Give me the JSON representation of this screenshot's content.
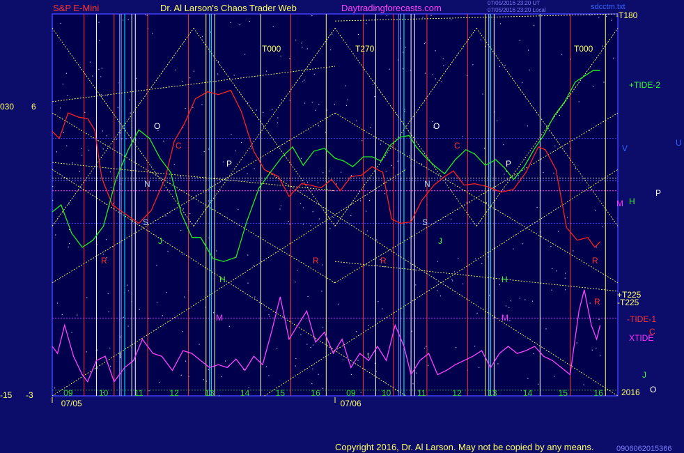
{
  "header": {
    "market": "S&P E-Mini",
    "site": "Dr. Al Larson's Chaos Trader Web",
    "url": "Daytradingforecasts.com",
    "stamp1": "07/05/2016 23:20 UT",
    "stamp2": "07/05/2016 23:20 Local",
    "file": "sdcctm.txt"
  },
  "footer": {
    "copyright": "Copyright 2016, Dr. Al Larson. May not be copied by any means.",
    "code": "0906062015366"
  },
  "chart_data": {
    "type": "line",
    "x_dates": [
      "07/05",
      "07/06"
    ],
    "x_ticks": [
      "09",
      "10",
      "11",
      "12",
      "13",
      "14",
      "15",
      "16",
      "09",
      "10",
      "11",
      "12",
      "13",
      "14",
      "15",
      "16"
    ],
    "year_label": "2016",
    "left_axis_labels": [
      {
        "text": "030",
        "color": "#ffff66"
      },
      {
        "text": "6",
        "color": "#ffff66"
      },
      {
        "text": "-15",
        "color": "#ffff66"
      },
      {
        "text": "-3",
        "color": "#ffff66"
      }
    ],
    "right_labels": [
      {
        "text": "-T180",
        "color": "#ffff66"
      },
      {
        "text": "+TIDE-2",
        "color": "#33ff33"
      },
      {
        "text": "V",
        "color": "#3366ff"
      },
      {
        "text": "U",
        "color": "#3366ff"
      },
      {
        "text": "P",
        "color": "#ffffff"
      },
      {
        "text": "H",
        "color": "#33ff33"
      },
      {
        "text": "M",
        "color": "#ff33ff"
      },
      {
        "text": "+T225",
        "color": "#ffff66"
      },
      {
        "text": "-T225",
        "color": "#ffff66"
      },
      {
        "text": "-TIDE-1",
        "color": "#ff3333"
      },
      {
        "text": "C",
        "color": "#ff3333"
      },
      {
        "text": "XTIDE",
        "color": "#ff33ff"
      },
      {
        "text": "J",
        "color": "#33ff33"
      },
      {
        "text": "2016",
        "color": "#ffff66"
      },
      {
        "text": "O",
        "color": "#ffffff"
      }
    ],
    "top_labels": [
      "T000",
      "T270",
      "T000"
    ],
    "event_letters": [
      {
        "text": "O",
        "color": "#ffffff"
      },
      {
        "text": "C",
        "color": "#ff3333"
      },
      {
        "text": "N",
        "color": "#aaddff"
      },
      {
        "text": "P",
        "color": "#ffffff"
      },
      {
        "text": "S",
        "color": "#aaddff"
      },
      {
        "text": "J",
        "color": "#33ff33"
      },
      {
        "text": "R",
        "color": "#ff3333"
      },
      {
        "text": "H",
        "color": "#33ff33"
      },
      {
        "text": "M",
        "color": "#ff33ff"
      },
      {
        "text": "R",
        "color": "#ff3333"
      },
      {
        "text": "O",
        "color": "#ffffff"
      },
      {
        "text": "C",
        "color": "#ff3333"
      },
      {
        "text": "N",
        "color": "#aaddff"
      },
      {
        "text": "P",
        "color": "#ffffff"
      },
      {
        "text": "S",
        "color": "#aaddff"
      },
      {
        "text": "J",
        "color": "#33ff33"
      },
      {
        "text": "R",
        "color": "#ff3333"
      },
      {
        "text": "H",
        "color": "#33ff33"
      },
      {
        "text": "M",
        "color": "#ff33ff"
      },
      {
        "text": "R",
        "color": "#ff3333"
      },
      {
        "text": "R",
        "color": "#ff3333"
      },
      {
        "text": "t",
        "color": "#aaaaaa"
      },
      {
        "text": "t",
        "color": "#aaaaaa"
      }
    ],
    "series": [
      {
        "name": "-TIDE-1",
        "color": "#ff2020",
        "points": [
          [
            0,
            3.7
          ],
          [
            0.2,
            3.2
          ],
          [
            0.45,
            5.0
          ],
          [
            0.75,
            4.7
          ],
          [
            1.0,
            4.6
          ],
          [
            1.2,
            3.8
          ],
          [
            1.4,
            0.4
          ],
          [
            1.7,
            -1.5
          ],
          [
            2.1,
            -2.2
          ],
          [
            2.45,
            -2.8
          ],
          [
            2.8,
            -1.9
          ],
          [
            3.2,
            0.4
          ],
          [
            3.45,
            3.0
          ],
          [
            3.75,
            4.3
          ],
          [
            4.05,
            6.0
          ],
          [
            4.4,
            6.5
          ],
          [
            4.7,
            6.3
          ],
          [
            5.05,
            6.6
          ],
          [
            5.35,
            5.1
          ],
          [
            5.7,
            2.3
          ],
          [
            6.0,
            1.0
          ],
          [
            6.4,
            0.5
          ],
          [
            6.7,
            -0.9
          ],
          [
            7.05,
            0.0
          ],
          [
            7.3,
            -0.1
          ],
          [
            7.6,
            -0.3
          ],
          [
            7.9,
            0.3
          ],
          [
            8.15,
            -0.5
          ],
          [
            8.45,
            0.5
          ],
          [
            8.75,
            0.6
          ],
          [
            9.05,
            1.2
          ],
          [
            9.35,
            0.8
          ],
          [
            9.6,
            -2.5
          ],
          [
            9.85,
            -2.8
          ],
          [
            10.15,
            -2.7
          ],
          [
            10.45,
            -1.2
          ],
          [
            10.8,
            -0.1
          ],
          [
            11.1,
            0.5
          ],
          [
            11.35,
            0.9
          ],
          [
            11.65,
            -0.1
          ],
          [
            11.95,
            0.0
          ],
          [
            12.3,
            -0.2
          ],
          [
            12.7,
            -0.6
          ],
          [
            13.05,
            -0.4
          ],
          [
            13.4,
            0.8
          ],
          [
            13.75,
            2.6
          ],
          [
            13.95,
            2.4
          ],
          [
            14.25,
            1.0
          ],
          [
            14.55,
            -3.1
          ],
          [
            14.85,
            -4.0
          ],
          [
            15.15,
            -3.8
          ],
          [
            15.35,
            -4.5
          ],
          [
            15.5,
            -4.1
          ]
        ]
      },
      {
        "name": "+TIDE-2",
        "color": "#20ee20",
        "points": [
          [
            0,
            -2.0
          ],
          [
            0.25,
            -1.5
          ],
          [
            0.55,
            -3.5
          ],
          [
            0.85,
            -4.5
          ],
          [
            1.15,
            -4.0
          ],
          [
            1.45,
            -3.0
          ],
          [
            1.8,
            0.3
          ],
          [
            2.15,
            2.4
          ],
          [
            2.45,
            3.8
          ],
          [
            2.75,
            3.2
          ],
          [
            3.05,
            1.8
          ],
          [
            3.35,
            0.8
          ],
          [
            3.65,
            -2.1
          ],
          [
            3.95,
            -3.8
          ],
          [
            4.2,
            -3.8
          ],
          [
            4.55,
            -5.3
          ],
          [
            4.85,
            -5.5
          ],
          [
            5.2,
            -5.2
          ],
          [
            5.5,
            -2.7
          ],
          [
            5.85,
            -0.3
          ],
          [
            6.2,
            0.9
          ],
          [
            6.5,
            1.9
          ],
          [
            6.8,
            2.6
          ],
          [
            7.1,
            1.3
          ],
          [
            7.4,
            2.3
          ],
          [
            7.7,
            2.5
          ],
          [
            8.0,
            1.8
          ],
          [
            8.25,
            1.6
          ],
          [
            8.5,
            1.2
          ],
          [
            8.8,
            1.9
          ],
          [
            9.05,
            1.9
          ],
          [
            9.3,
            1.6
          ],
          [
            9.55,
            2.7
          ],
          [
            9.85,
            3.3
          ],
          [
            10.1,
            3.4
          ],
          [
            10.3,
            2.6
          ],
          [
            10.55,
            1.9
          ],
          [
            10.8,
            1.3
          ],
          [
            11.1,
            0.7
          ],
          [
            11.4,
            1.7
          ],
          [
            11.7,
            2.4
          ],
          [
            11.95,
            2.1
          ],
          [
            12.25,
            1.3
          ],
          [
            12.55,
            1.7
          ],
          [
            12.8,
            1.1
          ],
          [
            13.05,
            0.3
          ],
          [
            13.35,
            1.2
          ],
          [
            13.65,
            2.5
          ],
          [
            13.9,
            3.4
          ],
          [
            14.2,
            4.8
          ],
          [
            14.5,
            5.8
          ],
          [
            14.8,
            7.2
          ],
          [
            15.05,
            7.6
          ],
          [
            15.3,
            8.0
          ],
          [
            15.5,
            8.0
          ]
        ]
      },
      {
        "name": "XTIDE",
        "color": "#ff44ff",
        "points": [
          [
            0,
            -11.5
          ],
          [
            0.15,
            -12.0
          ],
          [
            0.35,
            -10.0
          ],
          [
            0.6,
            -12.2
          ],
          [
            0.85,
            -13.5
          ],
          [
            1.0,
            -14.0
          ],
          [
            1.25,
            -12.5
          ],
          [
            1.5,
            -12.2
          ],
          [
            1.75,
            -14.0
          ],
          [
            2.05,
            -13.0
          ],
          [
            2.3,
            -12.5
          ],
          [
            2.55,
            -11.0
          ],
          [
            2.85,
            -12.0
          ],
          [
            3.1,
            -12.2
          ],
          [
            3.4,
            -13.2
          ],
          [
            3.7,
            -11.8
          ],
          [
            3.95,
            -12.0
          ],
          [
            4.2,
            -12.5
          ],
          [
            4.45,
            -13.0
          ],
          [
            4.7,
            -12.8
          ],
          [
            4.95,
            -13.0
          ],
          [
            5.2,
            -12.4
          ],
          [
            5.45,
            -13.2
          ],
          [
            5.7,
            -12.2
          ],
          [
            5.95,
            -12.8
          ],
          [
            6.2,
            -10.5
          ],
          [
            6.45,
            -8.0
          ],
          [
            6.7,
            -11.0
          ],
          [
            6.95,
            -10.0
          ],
          [
            7.2,
            -9.0
          ],
          [
            7.45,
            -11.2
          ],
          [
            7.7,
            -10.5
          ],
          [
            7.95,
            -12.0
          ],
          [
            8.2,
            -11.0
          ],
          [
            8.45,
            -13.0
          ],
          [
            8.7,
            -12.0
          ],
          [
            8.95,
            -12.5
          ],
          [
            9.2,
            -11.5
          ],
          [
            9.45,
            -12.5
          ],
          [
            9.7,
            -10.0
          ],
          [
            9.95,
            -11.5
          ],
          [
            10.15,
            -13.5
          ],
          [
            10.4,
            -12.5
          ],
          [
            10.65,
            -12.0
          ],
          [
            10.9,
            -13.5
          ],
          [
            11.15,
            -13.2
          ],
          [
            11.4,
            -12.8
          ],
          [
            11.65,
            -12.5
          ],
          [
            11.9,
            -12.2
          ],
          [
            12.15,
            -11.8
          ],
          [
            12.4,
            -13.0
          ],
          [
            12.65,
            -12.0
          ],
          [
            12.9,
            -11.5
          ],
          [
            13.15,
            -12.0
          ],
          [
            13.4,
            -11.8
          ],
          [
            13.65,
            -11.5
          ],
          [
            13.9,
            -12.2
          ],
          [
            14.15,
            -12.5
          ],
          [
            14.4,
            -13.0
          ],
          [
            14.65,
            -13.5
          ],
          [
            14.9,
            -9.0
          ],
          [
            15.05,
            -7.5
          ],
          [
            15.25,
            -10.0
          ],
          [
            15.4,
            -11.0
          ],
          [
            15.5,
            -10.0
          ]
        ]
      }
    ],
    "ylim": [
      -15,
      12
    ],
    "xlim": [
      0,
      16
    ],
    "grid": "on"
  }
}
